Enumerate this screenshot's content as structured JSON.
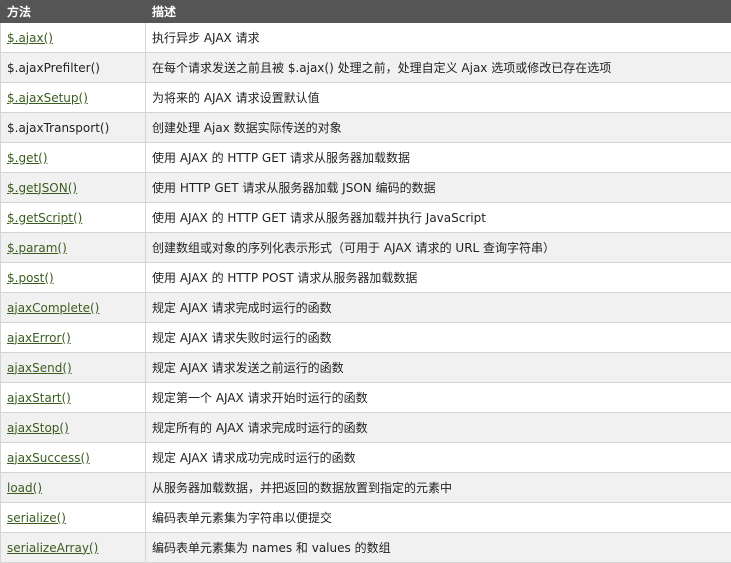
{
  "table": {
    "headers": [
      "方法",
      "描述"
    ],
    "rows": [
      {
        "method": "$.ajax()",
        "link": true,
        "description": "执行异步 AJAX 请求"
      },
      {
        "method": "$.ajaxPrefilter()",
        "link": false,
        "description": "在每个请求发送之前且被 $.ajax() 处理之前，处理自定义 Ajax 选项或修改已存在选项"
      },
      {
        "method": "$.ajaxSetup()",
        "link": true,
        "description": "为将来的 AJAX 请求设置默认值"
      },
      {
        "method": "$.ajaxTransport()",
        "link": false,
        "description": "创建处理 Ajax 数据实际传送的对象"
      },
      {
        "method": "$.get()",
        "link": true,
        "description": "使用 AJAX 的 HTTP GET 请求从服务器加载数据"
      },
      {
        "method": "$.getJSON()",
        "link": true,
        "description": "使用 HTTP GET 请求从服务器加载 JSON 编码的数据"
      },
      {
        "method": "$.getScript()",
        "link": true,
        "description": "使用 AJAX 的 HTTP GET 请求从服务器加载并执行 JavaScript"
      },
      {
        "method": "$.param()",
        "link": true,
        "description": "创建数组或对象的序列化表示形式（可用于 AJAX 请求的 URL 查询字符串）"
      },
      {
        "method": "$.post()",
        "link": true,
        "description": "使用 AJAX 的 HTTP POST 请求从服务器加载数据"
      },
      {
        "method": "ajaxComplete()",
        "link": true,
        "description": "规定 AJAX 请求完成时运行的函数"
      },
      {
        "method": "ajaxError()",
        "link": true,
        "description": "规定 AJAX 请求失败时运行的函数"
      },
      {
        "method": "ajaxSend()",
        "link": true,
        "description": "规定 AJAX 请求发送之前运行的函数"
      },
      {
        "method": "ajaxStart()",
        "link": true,
        "description": "规定第一个 AJAX 请求开始时运行的函数"
      },
      {
        "method": "ajaxStop()",
        "link": true,
        "description": "规定所有的 AJAX 请求完成时运行的函数"
      },
      {
        "method": "ajaxSuccess()",
        "link": true,
        "description": "规定 AJAX 请求成功完成时运行的函数"
      },
      {
        "method": "load()",
        "link": true,
        "description": "从服务器加载数据，并把返回的数据放置到指定的元素中"
      },
      {
        "method": "serialize()",
        "link": true,
        "description": "编码表单元素集为字符串以便提交"
      },
      {
        "method": "serializeArray()",
        "link": true,
        "description": "编码表单元素集为 names 和 values 的数组"
      }
    ]
  },
  "colors": {
    "header_bg": "#555555",
    "header_text": "#ffffff",
    "link": "#3a5d1f",
    "row_alt": "#f1f1f1",
    "border": "#d4d4d4"
  }
}
